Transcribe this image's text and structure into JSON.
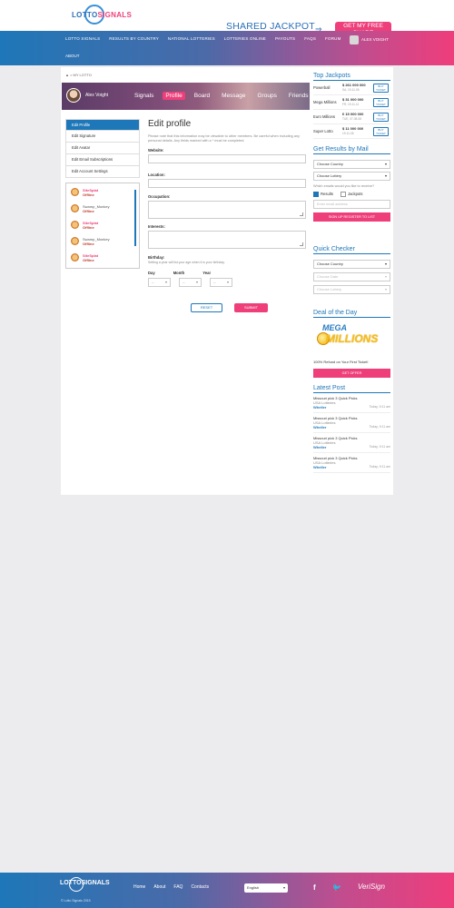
{
  "header": {
    "logo_left": "LOTTO",
    "logo_right": "SIGNALS",
    "jackpot_title": "SHARED JACKPOT",
    "jackpot_button": "GET MY FREE SHARE"
  },
  "nav": {
    "items": [
      "LOTTO SIGNALS",
      "RESULTS BY COUNTRY",
      "NATIONAL LOTTERIES",
      "LOTTERIES ONLINE",
      "PAYOUTS",
      "FAQS",
      "FORUM"
    ],
    "about": "ABOUT",
    "user": "ALEX VOIGHT"
  },
  "breadcrumb": "▲ > MY LOTTO",
  "profile": {
    "name": "Alex Voight",
    "tabs": [
      "Signals",
      "Profile",
      "Board",
      "Message",
      "Groups",
      "Friends"
    ],
    "active_tab": "Profile"
  },
  "sidebar": {
    "items": [
      "Edit Profile",
      "Edit Signature",
      "Edit Avatar",
      "Edit Email Subscriptions",
      "Edit Account Settings"
    ]
  },
  "friends": [
    {
      "name": "SiteSplat",
      "status": "Offline"
    },
    {
      "name": "Swamp_Monkey",
      "status": "Offline"
    },
    {
      "name": "SiteSplat",
      "status": "Offline"
    },
    {
      "name": "Swamp_Monkey",
      "status": "Offline"
    },
    {
      "name": "SiteSplat",
      "status": "Offline"
    }
  ],
  "form": {
    "title": "Edit profile",
    "note": "Please note that this information may be viewable to other members. Be careful when including any personal details. Any fields marked with a * must be completed.",
    "website_label": "Website:",
    "location_label": "Location:",
    "occupation_label": "Occupation:",
    "interests_label": "Interests:",
    "birthday_label": "Birthday:",
    "birthday_note": "Setting a year will list your age when it is your birthday.",
    "day_label": "Day",
    "month_label": "Month",
    "year_label": "Year",
    "day_value": "--",
    "month_value": "--",
    "year_value": "--",
    "reset": "RESET",
    "submit": "SUBMIT"
  },
  "top_jackpots": {
    "title": "Top Jackpots",
    "rows": [
      {
        "name": "Powerball",
        "amount": "$ 261 000 000",
        "date": "SA, 19-11-06",
        "buy": "BUY TICKET"
      },
      {
        "name": "Mega Millions",
        "amount": "$ 31 000 000",
        "date": "FR, 19-11-11",
        "buy": "BUY TICKET"
      },
      {
        "name": "Euro Millions",
        "amount": "€ 15 000 000",
        "date": "TUE, 07-08-08",
        "buy": "BUY TICKET"
      },
      {
        "name": "Super Lotto",
        "amount": "$ 11 000 000",
        "date": "19-11-06",
        "buy": "BUY TICKET"
      }
    ]
  },
  "results_mail": {
    "title": "Get Results by Mail",
    "country": "Choose Country",
    "lottery": "Choose Lottery",
    "question": "Which emails would you like to receive?",
    "opt_results": "Results",
    "opt_jackpots": "Jackpots",
    "email_placeholder": "Enter email address",
    "button": "SIGN UP REGISTER TO LIST"
  },
  "quick_checker": {
    "title": "Quick Checker",
    "country": "Choose Country",
    "date": "Choose Date",
    "lottery": "Choose Lottery"
  },
  "deal": {
    "title": "Deal of the Day",
    "logo_top": "MEGA",
    "logo_bottom": "MILLIONS",
    "refund": "100% Refund on Your First Ticket!",
    "button": "GET OFFER"
  },
  "latest_post": {
    "title": "Latest Post",
    "posts": [
      {
        "title": "Missouri pick 3 Quick Picks",
        "cat": "USA Lotteries",
        "author": "Wheller",
        "time": "Today, 9:11 am"
      },
      {
        "title": "Missouri pick 3 Quick Picks",
        "cat": "USA Lotteries",
        "author": "Wheller",
        "time": "Today, 9:11 am"
      },
      {
        "title": "Missouri pick 3 Quick Picks",
        "cat": "USA Lotteries",
        "author": "Wheller",
        "time": "Today, 9:11 am"
      },
      {
        "title": "Missouri pick 3 Quick Picks",
        "cat": "USA Lotteries",
        "author": "Wheller",
        "time": "Today, 9:11 am"
      }
    ]
  },
  "footer": {
    "logo": "LOTTOSIGNALS",
    "copyright": "© Lotto Signals 2015",
    "links": [
      "Home",
      "About",
      "FAQ",
      "Contacts"
    ],
    "language": "English",
    "verisign": "VeriSign"
  },
  "colors": {
    "blue": "#1e77b8",
    "pink": "#ee3f7a"
  }
}
